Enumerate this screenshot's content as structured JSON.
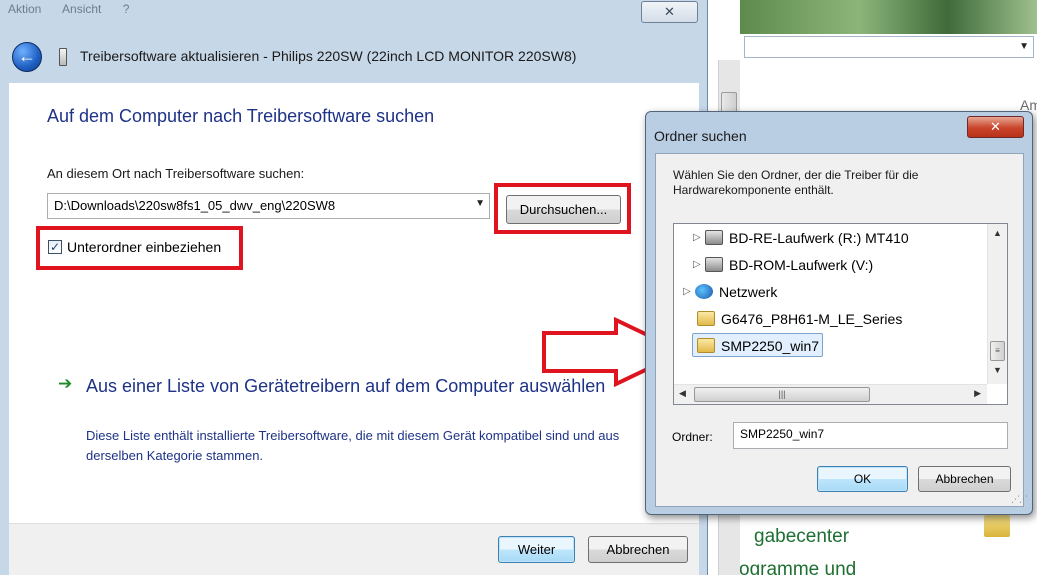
{
  "background": {
    "right_link_1": "gabecenter",
    "right_link_2": "Programme und",
    "right_partial_label": "Am"
  },
  "wizard": {
    "menu": [
      "Aktion",
      "Ansicht",
      "?"
    ],
    "close_label": "✕",
    "title": "Treibersoftware aktualisieren - Philips 220SW (22inch LCD MONITOR 220SW8)",
    "heading": "Auf dem Computer nach Treibersoftware suchen",
    "path_label": "An diesem Ort nach Treibersoftware suchen:",
    "path_value": "D:\\Downloads\\220sw8fs1_05_dwv_eng\\220SW8",
    "browse_label": "Durchsuchen...",
    "include_subfolders_label": "Unterordner einbeziehen",
    "include_subfolders_checked": true,
    "option_title": "Aus einer Liste von Gerätetreibern auf dem Computer auswählen",
    "option_desc": "Diese Liste enthält installierte Treibersoftware, die mit diesem Gerät kompatibel sind und aus derselben Kategorie stammen.",
    "next_label": "Weiter",
    "cancel_label": "Abbrechen"
  },
  "folder_dialog": {
    "title": "Ordner suchen",
    "close_label": "✕",
    "description": "Wählen Sie den Ordner, der die Treiber für die Hardwarekomponente enthält.",
    "tree_items": [
      {
        "label": "BD-RE-Laufwerk (R:) MT410",
        "icon": "drive-icon",
        "expander": "▷"
      },
      {
        "label": "BD-ROM-Laufwerk (V:)",
        "icon": "drive-icon",
        "expander": "▷"
      },
      {
        "label": "Netzwerk",
        "icon": "network-icon",
        "expander": "▷"
      },
      {
        "label": "G6476_P8H61-M_LE_Series",
        "icon": "folder-icon",
        "expander": ""
      },
      {
        "label": "SMP2250_win7",
        "icon": "folder-icon",
        "expander": "",
        "selected": true
      }
    ],
    "folder_label": "Ordner:",
    "folder_value": "SMP2250_win7",
    "ok_label": "OK",
    "cancel_label": "Abbrechen"
  },
  "colors": {
    "highlight_red": "#e0141f",
    "heading_blue": "#1e3287",
    "link_green": "#1e6f32"
  }
}
